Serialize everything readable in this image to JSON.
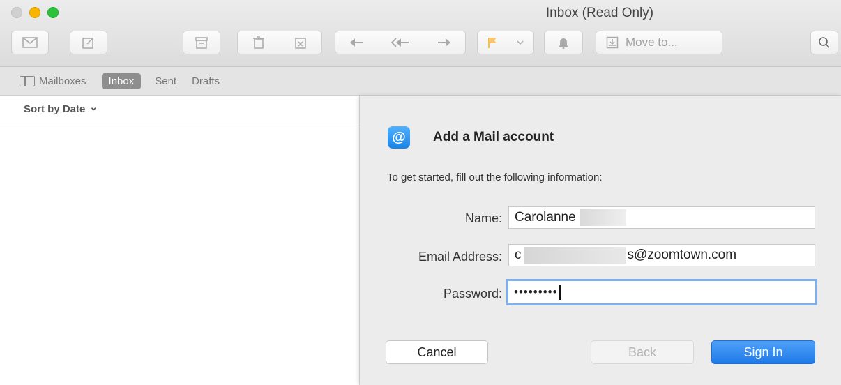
{
  "window": {
    "title": "Inbox (Read Only)"
  },
  "toolbar": {
    "buttons": [
      {
        "name": "get-mail",
        "icon": "envelope-icon"
      },
      {
        "name": "compose",
        "icon": "compose-icon"
      },
      {
        "name": "archive",
        "icon": "archive-icon"
      },
      {
        "name": "delete",
        "icon": "trash-icon"
      },
      {
        "name": "junk",
        "icon": "junk-icon"
      },
      {
        "name": "reply",
        "icon": "reply-icon"
      },
      {
        "name": "reply-all",
        "icon": "reply-all-icon"
      },
      {
        "name": "forward",
        "icon": "forward-icon"
      },
      {
        "name": "flag",
        "icon": "flag-icon"
      },
      {
        "name": "flag-menu",
        "icon": "chevron-down-icon"
      },
      {
        "name": "notify",
        "icon": "bell-icon"
      },
      {
        "name": "search",
        "icon": "search-icon"
      }
    ],
    "move_to_label": "Move to..."
  },
  "favorites": {
    "mailboxes_label": "Mailboxes",
    "inbox_label": "Inbox",
    "sent_label": "Sent",
    "drafts_label": "Drafts"
  },
  "message_list": {
    "sort_label": "Sort by Date",
    "sort_chevron": "⌄"
  },
  "sheet": {
    "icon_glyph": "@",
    "title": "Add a Mail account",
    "subtitle": "To get started, fill out the following information:",
    "name": {
      "label": "Name:",
      "value": "Carolanne"
    },
    "email": {
      "label": "Email Address:",
      "value_prefix": "c",
      "value_suffix": "s@zoomtown.com"
    },
    "password": {
      "label": "Password:",
      "value": "•••••••••"
    },
    "buttons": {
      "cancel": "Cancel",
      "back": "Back",
      "sign_in": "Sign In"
    }
  },
  "colors": {
    "accent": "#1f7ae8",
    "focus_ring": "#7eb1ec",
    "traffic_min": "#f7b500",
    "traffic_max": "#2bc23a",
    "flag": "#f5a623"
  }
}
